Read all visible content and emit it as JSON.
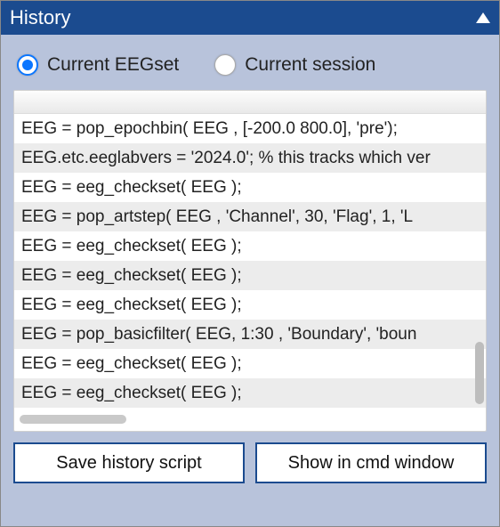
{
  "header": {
    "title": "History"
  },
  "radios": {
    "current_eegset": {
      "label": "Current EEGset",
      "selected": true
    },
    "current_session": {
      "label": "Current session",
      "selected": false
    }
  },
  "history_lines": [
    "EEG = pop_epochbin( EEG , [-200.0  800.0],  'pre');",
    "EEG.etc.eeglabvers = '2024.0'; % this tracks which ver",
    "EEG = eeg_checkset( EEG );",
    "EEG  = pop_artstep( EEG , 'Channel',  30, 'Flag',  1, 'L",
    "EEG = eeg_checkset( EEG );",
    "EEG = eeg_checkset( EEG );",
    "EEG = eeg_checkset( EEG );",
    "EEG  = pop_basicfilter( EEG,  1:30 , 'Boundary', 'boun",
    "EEG = eeg_checkset( EEG );",
    "EEG = eeg_checkset( EEG );"
  ],
  "buttons": {
    "save_script": "Save history script",
    "show_cmd": "Show in cmd window"
  }
}
